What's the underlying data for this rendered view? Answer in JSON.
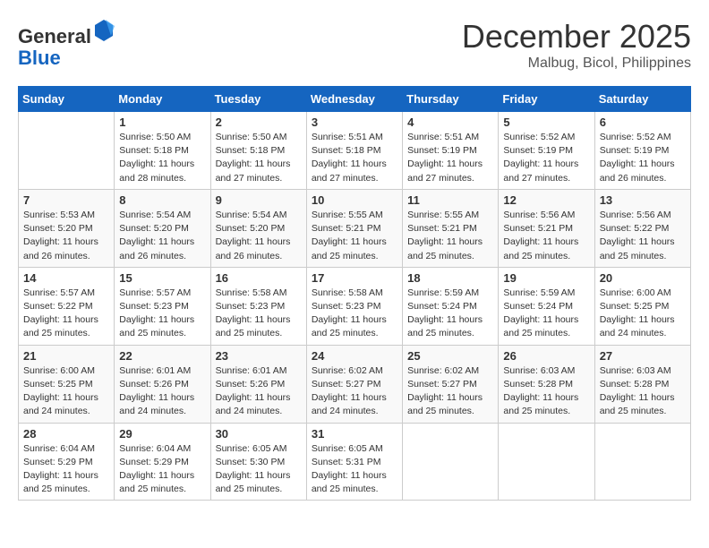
{
  "logo": {
    "general": "General",
    "blue": "Blue"
  },
  "header": {
    "month": "December 2025",
    "location": "Malbug, Bicol, Philippines"
  },
  "days_of_week": [
    "Sunday",
    "Monday",
    "Tuesday",
    "Wednesday",
    "Thursday",
    "Friday",
    "Saturday"
  ],
  "weeks": [
    [
      {
        "day": "",
        "info": ""
      },
      {
        "day": "1",
        "info": "Sunrise: 5:50 AM\nSunset: 5:18 PM\nDaylight: 11 hours\nand 28 minutes."
      },
      {
        "day": "2",
        "info": "Sunrise: 5:50 AM\nSunset: 5:18 PM\nDaylight: 11 hours\nand 27 minutes."
      },
      {
        "day": "3",
        "info": "Sunrise: 5:51 AM\nSunset: 5:18 PM\nDaylight: 11 hours\nand 27 minutes."
      },
      {
        "day": "4",
        "info": "Sunrise: 5:51 AM\nSunset: 5:19 PM\nDaylight: 11 hours\nand 27 minutes."
      },
      {
        "day": "5",
        "info": "Sunrise: 5:52 AM\nSunset: 5:19 PM\nDaylight: 11 hours\nand 27 minutes."
      },
      {
        "day": "6",
        "info": "Sunrise: 5:52 AM\nSunset: 5:19 PM\nDaylight: 11 hours\nand 26 minutes."
      }
    ],
    [
      {
        "day": "7",
        "info": "Sunrise: 5:53 AM\nSunset: 5:20 PM\nDaylight: 11 hours\nand 26 minutes."
      },
      {
        "day": "8",
        "info": "Sunrise: 5:54 AM\nSunset: 5:20 PM\nDaylight: 11 hours\nand 26 minutes."
      },
      {
        "day": "9",
        "info": "Sunrise: 5:54 AM\nSunset: 5:20 PM\nDaylight: 11 hours\nand 26 minutes."
      },
      {
        "day": "10",
        "info": "Sunrise: 5:55 AM\nSunset: 5:21 PM\nDaylight: 11 hours\nand 25 minutes."
      },
      {
        "day": "11",
        "info": "Sunrise: 5:55 AM\nSunset: 5:21 PM\nDaylight: 11 hours\nand 25 minutes."
      },
      {
        "day": "12",
        "info": "Sunrise: 5:56 AM\nSunset: 5:21 PM\nDaylight: 11 hours\nand 25 minutes."
      },
      {
        "day": "13",
        "info": "Sunrise: 5:56 AM\nSunset: 5:22 PM\nDaylight: 11 hours\nand 25 minutes."
      }
    ],
    [
      {
        "day": "14",
        "info": "Sunrise: 5:57 AM\nSunset: 5:22 PM\nDaylight: 11 hours\nand 25 minutes."
      },
      {
        "day": "15",
        "info": "Sunrise: 5:57 AM\nSunset: 5:23 PM\nDaylight: 11 hours\nand 25 minutes."
      },
      {
        "day": "16",
        "info": "Sunrise: 5:58 AM\nSunset: 5:23 PM\nDaylight: 11 hours\nand 25 minutes."
      },
      {
        "day": "17",
        "info": "Sunrise: 5:58 AM\nSunset: 5:23 PM\nDaylight: 11 hours\nand 25 minutes."
      },
      {
        "day": "18",
        "info": "Sunrise: 5:59 AM\nSunset: 5:24 PM\nDaylight: 11 hours\nand 25 minutes."
      },
      {
        "day": "19",
        "info": "Sunrise: 5:59 AM\nSunset: 5:24 PM\nDaylight: 11 hours\nand 25 minutes."
      },
      {
        "day": "20",
        "info": "Sunrise: 6:00 AM\nSunset: 5:25 PM\nDaylight: 11 hours\nand 24 minutes."
      }
    ],
    [
      {
        "day": "21",
        "info": "Sunrise: 6:00 AM\nSunset: 5:25 PM\nDaylight: 11 hours\nand 24 minutes."
      },
      {
        "day": "22",
        "info": "Sunrise: 6:01 AM\nSunset: 5:26 PM\nDaylight: 11 hours\nand 24 minutes."
      },
      {
        "day": "23",
        "info": "Sunrise: 6:01 AM\nSunset: 5:26 PM\nDaylight: 11 hours\nand 24 minutes."
      },
      {
        "day": "24",
        "info": "Sunrise: 6:02 AM\nSunset: 5:27 PM\nDaylight: 11 hours\nand 24 minutes."
      },
      {
        "day": "25",
        "info": "Sunrise: 6:02 AM\nSunset: 5:27 PM\nDaylight: 11 hours\nand 25 minutes."
      },
      {
        "day": "26",
        "info": "Sunrise: 6:03 AM\nSunset: 5:28 PM\nDaylight: 11 hours\nand 25 minutes."
      },
      {
        "day": "27",
        "info": "Sunrise: 6:03 AM\nSunset: 5:28 PM\nDaylight: 11 hours\nand 25 minutes."
      }
    ],
    [
      {
        "day": "28",
        "info": "Sunrise: 6:04 AM\nSunset: 5:29 PM\nDaylight: 11 hours\nand 25 minutes."
      },
      {
        "day": "29",
        "info": "Sunrise: 6:04 AM\nSunset: 5:29 PM\nDaylight: 11 hours\nand 25 minutes."
      },
      {
        "day": "30",
        "info": "Sunrise: 6:05 AM\nSunset: 5:30 PM\nDaylight: 11 hours\nand 25 minutes."
      },
      {
        "day": "31",
        "info": "Sunrise: 6:05 AM\nSunset: 5:31 PM\nDaylight: 11 hours\nand 25 minutes."
      },
      {
        "day": "",
        "info": ""
      },
      {
        "day": "",
        "info": ""
      },
      {
        "day": "",
        "info": ""
      }
    ]
  ]
}
